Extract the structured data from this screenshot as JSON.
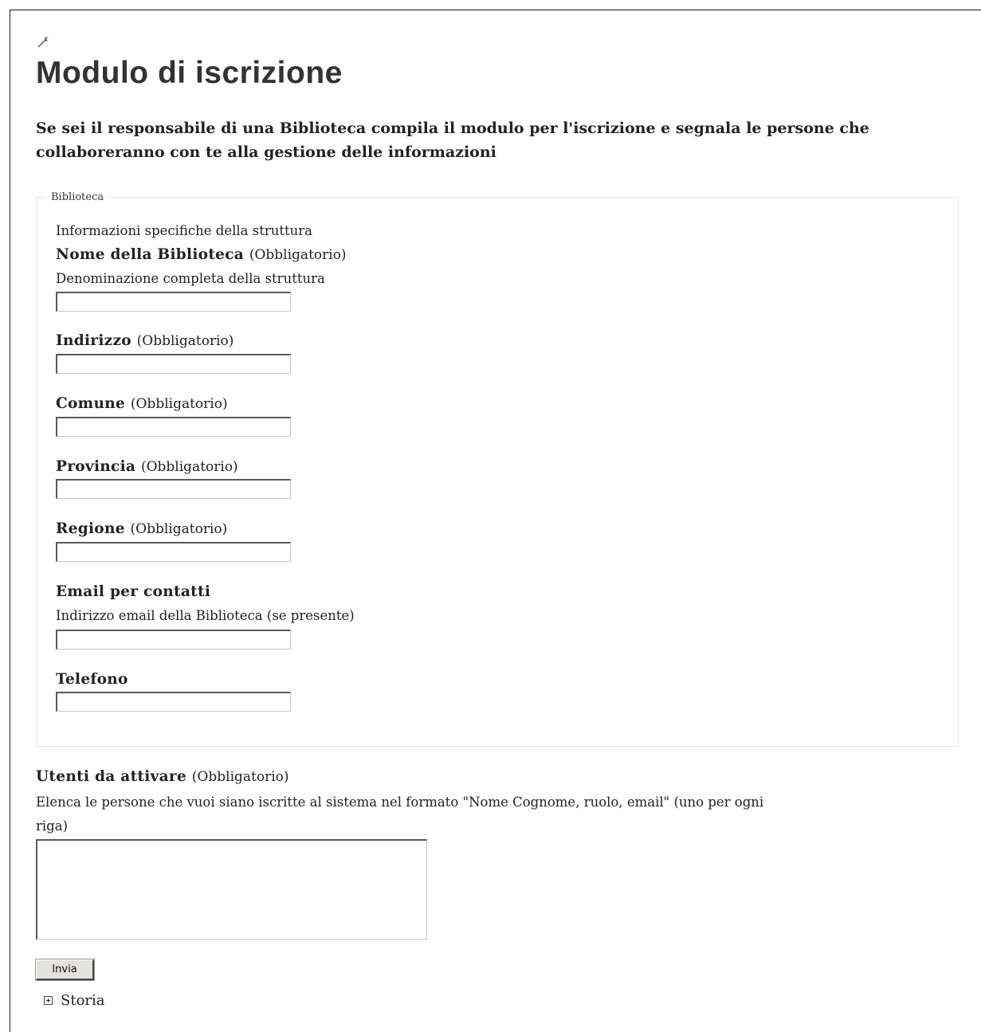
{
  "page": {
    "title": "Modulo di iscrizione",
    "intro": "Se sei il responsabile di una Biblioteca compila il modulo per l'iscrizione e segnala le persone che collaboreranno con te alla gestione delle informazioni",
    "icon": "wrench-icon"
  },
  "fieldset": {
    "legend": "Biblioteca",
    "description": "Informazioni specifiche della struttura",
    "fields": [
      {
        "label": "Nome della Biblioteca",
        "required": "(Obbligatorio)",
        "help": "Denominazione completa della struttura",
        "value": ""
      },
      {
        "label": "Indirizzo",
        "required": "(Obbligatorio)",
        "value": ""
      },
      {
        "label": "Comune",
        "required": "(Obbligatorio)",
        "value": ""
      },
      {
        "label": "Provincia",
        "required": "(Obbligatorio)",
        "value": ""
      },
      {
        "label": "Regione",
        "required": "(Obbligatorio)",
        "value": ""
      },
      {
        "label": "Email per contatti",
        "help": "Indirizzo email della Biblioteca (se presente)",
        "value": ""
      },
      {
        "label": "Telefono",
        "value": ""
      }
    ]
  },
  "users": {
    "label": "Utenti da attivare",
    "required": "(Obbligatorio)",
    "help_line1": "Elenca le persone che vuoi siano iscritte al sistema nel formato \"Nome Cognome, ruolo, email\" (uno per ogni",
    "help_line2": "riga)",
    "value": ""
  },
  "submit_label": "Invia",
  "history": {
    "label": "Storia",
    "icon": "expand-plus-icon"
  }
}
